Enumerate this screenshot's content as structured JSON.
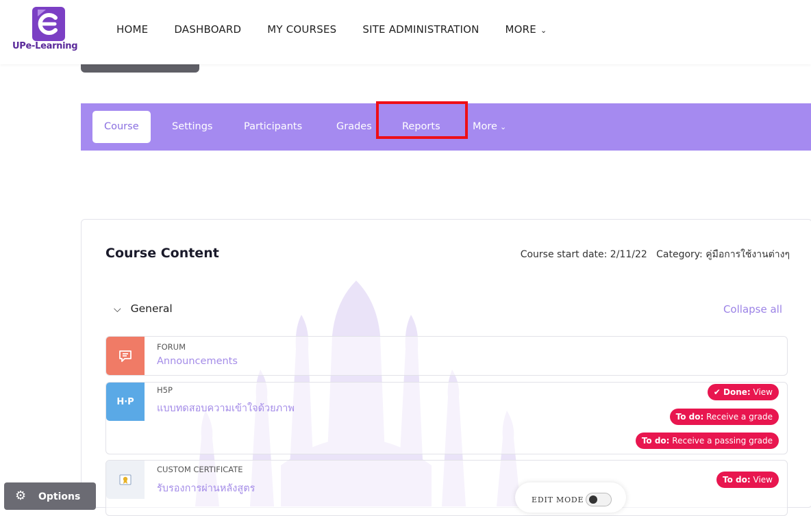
{
  "brand": {
    "logo_text": "UPe-Learning"
  },
  "nav": {
    "items": [
      "HOME",
      "DASHBOARD",
      "MY COURSES",
      "SITE ADMINISTRATION"
    ],
    "more_label": "MORE"
  },
  "course_tabs": {
    "course": "Course",
    "settings": "Settings",
    "participants": "Participants",
    "grades": "Grades",
    "reports": "Reports",
    "more": "More"
  },
  "content": {
    "title": "Course Content",
    "meta": "Course start date: 2/11/22   Category: คู่มือการใช้งานต่างๆ",
    "section_name": "General",
    "collapse_all": "Collapse all",
    "activities": [
      {
        "type": "FORUM",
        "name": "Announcements",
        "icon_color": "#f07b66",
        "icon": "forum-icon"
      },
      {
        "type": "H5P",
        "name": "แบบทดสอบความเข้าใจด้วยภาพ",
        "icon_color": "#5aa9e6",
        "icon": "h5p-icon",
        "badges": [
          {
            "strong": "✔ Done:",
            "text": " View"
          },
          {
            "strong": "To do:",
            "text": " Receive a grade"
          },
          {
            "strong": "To do:",
            "text": " Receive a passing grade"
          }
        ]
      },
      {
        "type": "CUSTOM CERTIFICATE",
        "name": "รับรองการผ่านหลังสูตร",
        "icon_color": "#eef1f6",
        "icon": "certificate-icon",
        "badges": [
          {
            "strong": "To do:",
            "text": " View"
          }
        ]
      }
    ]
  },
  "footer": {
    "options_label": "Options",
    "edit_mode_label": "EDIT MODE"
  },
  "colors": {
    "accent": "#a58af0",
    "badge": "#e8164f",
    "highlight": "#ee0f17"
  }
}
